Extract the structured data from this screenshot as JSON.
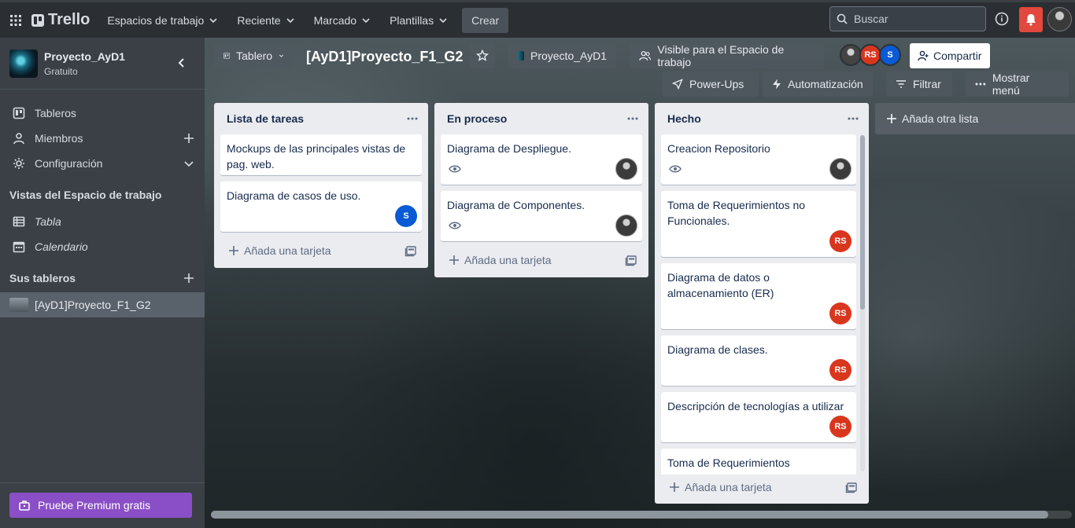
{
  "topnav": {
    "brand": "Trello",
    "menus": [
      "Espacios de trabajo",
      "Reciente",
      "Marcado",
      "Plantillas"
    ],
    "create": "Crear",
    "search_placeholder": "Buscar"
  },
  "sidebar": {
    "workspace_name": "Proyecto_AyD1",
    "workspace_plan": "Gratuito",
    "items": [
      {
        "label": "Tableros",
        "icon": "board-icon"
      },
      {
        "label": "Miembros",
        "icon": "person-icon"
      },
      {
        "label": "Configuración",
        "icon": "gear-icon"
      }
    ],
    "views_title": "Vistas del Espacio de trabajo",
    "views": [
      {
        "label": "Tabla",
        "icon": "table-icon"
      },
      {
        "label": "Calendario",
        "icon": "calendar-icon"
      }
    ],
    "boards_title": "Sus tableros",
    "boards": [
      "[AyD1]Proyecto_F1_G2"
    ],
    "premium": "Pruebe Premium gratis"
  },
  "board": {
    "view": "Tablero",
    "title": "[AyD1]Proyecto_F1_G2",
    "workspace": "Proyecto_AyD1",
    "visibility": "Visible para el Espacio de trabajo",
    "share": "Compartir",
    "powerups": "Power-Ups",
    "automation": "Automatización",
    "filter": "Filtrar",
    "menu": "Mostrar menú",
    "members": [
      {
        "initials": "",
        "type": "photo"
      },
      {
        "initials": "RS",
        "type": "rs"
      },
      {
        "initials": "S",
        "type": "s"
      }
    ]
  },
  "lists": [
    {
      "title": "Lista de tareas",
      "cards": [
        {
          "title": "Mockups de las principales vistas de pag. web.",
          "member": "",
          "watch": false
        },
        {
          "title": "Diagrama de casos de uso.",
          "member": "S",
          "watch": false
        }
      ],
      "add_card": "Añada una tarjeta"
    },
    {
      "title": "En proceso",
      "cards": [
        {
          "title": "Diagrama de Despliegue.",
          "member": "",
          "watch": true
        },
        {
          "title": "Diagrama de Componentes.",
          "member": "",
          "watch": true
        }
      ],
      "add_card": "Añada una tarjeta"
    },
    {
      "title": "Hecho",
      "cards": [
        {
          "title": "Creacion Repositorio",
          "member": "",
          "watch": true
        },
        {
          "title": "Toma de Requerimientos no Funcionales.",
          "member": "RS",
          "watch": false
        },
        {
          "title": "Diagrama de datos o almacenamiento (ER)",
          "member": "RS",
          "watch": false
        },
        {
          "title": "Diagrama de clases.",
          "member": "RS",
          "watch": false
        },
        {
          "title": "Descripción de tecnologías a utilizar",
          "member": "RS",
          "watch": false
        },
        {
          "title": "Toma de Requerimientos Funcionales",
          "member": "",
          "watch": false
        }
      ],
      "add_card": "Añada una tarjeta"
    }
  ],
  "add_list": "Añada otra lista",
  "colors": {
    "topnav": "#2b2f33",
    "sidebar": "#3a4046",
    "list": "#ebecf0",
    "avatar_rs": "#d9361e",
    "avatar_s": "#0a5ad6",
    "premium": "#8a4fc6",
    "bell": "#e2483d"
  }
}
